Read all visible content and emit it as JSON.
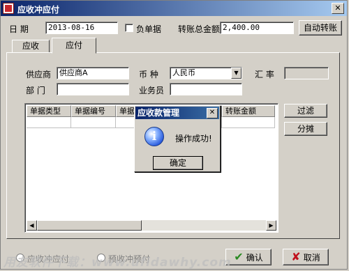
{
  "window": {
    "title": "应收冲应付",
    "close_glyph": "✕"
  },
  "header": {
    "date_label": "日  期",
    "date_value": "2013-08-16",
    "negative_label": "负单据",
    "total_label": "转账总金额",
    "total_value": "2,400.00",
    "auto_transfer_label": "自动转账"
  },
  "tabs": [
    {
      "label": "应收"
    },
    {
      "label": "应付"
    }
  ],
  "form": {
    "supplier_label": "供应商",
    "supplier_value": "供应商A",
    "currency_label": "币  种",
    "currency_value": "人民币",
    "rate_label": "汇  率",
    "rate_value": "",
    "department_label": "部  门",
    "department_value": "",
    "staff_label": "业务员",
    "staff_value": ""
  },
  "grid": {
    "columns": [
      "单据类型",
      "单据编号",
      "单据日期",
      "",
      "转账金额"
    ]
  },
  "side_buttons": {
    "filter_label": "过滤",
    "split_label": "分摊"
  },
  "dialog": {
    "title": "应收款管理",
    "message": "操作成功!",
    "ok_label": "确定",
    "icon": "info-icon"
  },
  "footer": {
    "radio1_label": "应收冲应付",
    "radio2_label": "预收冲预付",
    "confirm_label": "确认",
    "cancel_label": "取消",
    "watermark": "用友软件下载：www.ufidawhy.com"
  },
  "colors": {
    "titlebar_start": "#0a246a",
    "titlebar_end": "#a6caf0",
    "confirm_check": "#2a8a22",
    "cancel_x": "#c0101c"
  }
}
